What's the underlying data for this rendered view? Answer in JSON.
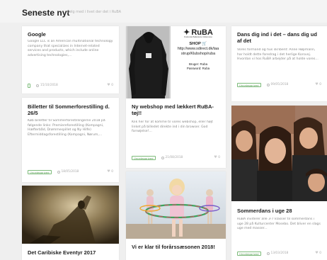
{
  "header": {
    "title": "Seneste nyt",
    "subtitle": "Følg med i livet der det i RuBA"
  },
  "colors": {
    "tag_green": "#5c9e58",
    "background": "#efefef"
  },
  "cards": [
    {
      "title": "Google",
      "excerpt": "Google LLC is an American multinational technology company that specializes in Internet-related services and products, which include online advertising technologies,...",
      "date": "15/10/2018",
      "likes": "0"
    },
    {
      "title": "Billetter til Sommerforestilling d. 26/5",
      "excerpt": "Køb billetter til Sommerforestillingerne 2018 på følgende links: Premiereforestilling (Kompagni, Hæfterbåd, Drømmespillet og Ny Hilfe) Eftermiddagsforestilling (Kompagni, Nørum,...",
      "tag": "Uncategorized",
      "date": "18/05/2018",
      "likes": "0"
    },
    {
      "title": "Det Caribiske Eventyr 2017"
    },
    {
      "title": "Ny webshop med lækkert RuBA-tøj!!",
      "excerpt": "Klik her for at komme til vores webshop, eller højt linket på billedet direkte ind i din browser. God fornøjelse!...",
      "tag": "Uncategorized",
      "date": "21/08/2018",
      "likes": "0",
      "image": {
        "logo": "RuBA",
        "logo_tagline": "Rudersdal Balletskole Uddannelse",
        "shop_label": "SHOP",
        "url_line1": "http://www.sdirect.dk/taa",
        "url_line2": "strup/Klubshop/ruba",
        "user": "Bruger: Ruba",
        "password": "Password: Ruba"
      }
    },
    {
      "title": "Vi er klar til forårssæsonen 2018!"
    },
    {
      "title": "Dans dig ind i det – dans dig ud af det",
      "excerpt": "Vores formand og hus skribent: Anne Høpmann, har holdt dette foredrag i det herlige Korsvej. Hvordan vi hos RuBA arbejder på at holde vores...",
      "tag": "Uncategorized",
      "date": "09/05/2018",
      "likes": "0"
    },
    {
      "title": "Sommerdans i uge 28",
      "excerpt": "RuBA inviterer alle 3-7 klasser til sommerdans i uge 28 på Kulturcenter Mosebo. Det bliver en slags uge med masser...",
      "tag": "Uncategorized",
      "date": "13/03/2018",
      "likes": "0"
    }
  ]
}
